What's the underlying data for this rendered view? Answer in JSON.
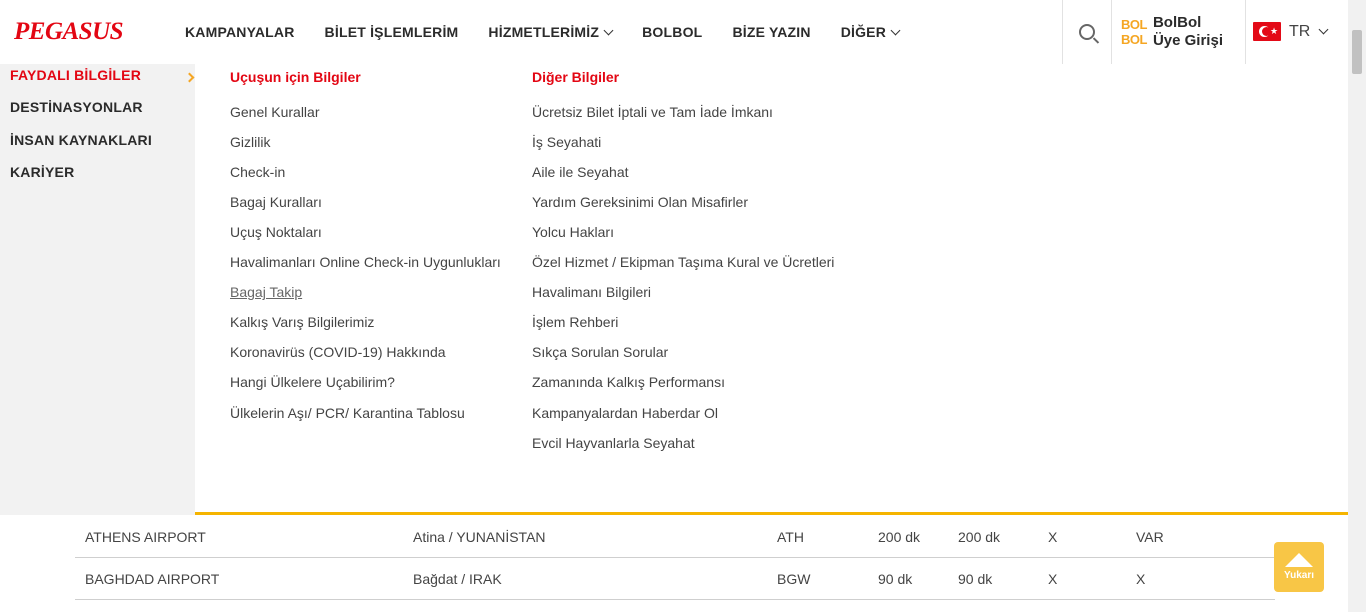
{
  "header": {
    "logo": "PEGASUS",
    "nav": [
      "KAMPANYALAR",
      "BİLET İŞLEMLERİM",
      "HİZMETLERİMİZ",
      "BOLBOL",
      "BİZE YAZIN",
      "DİĞER"
    ],
    "bolbol_logo_line1": "BOL",
    "bolbol_logo_line2": "BOL",
    "bolbol_line1": "BolBol",
    "bolbol_line2": "Üye Girişi",
    "lang": "TR"
  },
  "menu": {
    "side": [
      "FAYDALI BİLGİLER",
      "DESTİNASYONLAR",
      "İNSAN KAYNAKLARI",
      "KARİYER"
    ],
    "col1_title": "Uçuşun için Bilgiler",
    "col1": [
      "Genel Kurallar",
      "Gizlilik",
      "Check-in",
      "Bagaj Kuralları",
      "Uçuş Noktaları",
      "Havalimanları Online Check-in Uygunlukları",
      "Bagaj Takip",
      "Kalkış Varış Bilgilerimiz",
      "Koronavirüs (COVID-19) Hakkında",
      "Hangi Ülkelere Uçabilirim?",
      "Ülkelerin Aşı/ PCR/ Karantina Tablosu"
    ],
    "col2_title": "Diğer Bilgiler",
    "col2": [
      "Ücretsiz Bilet İptali ve Tam İade İmkanı",
      "İş Seyahati",
      "Aile ile Seyahat",
      "Yardım Gereksinimi Olan Misafirler",
      "Yolcu Hakları",
      "Özel Hizmet / Ekipman Taşıma Kural ve Ücretleri",
      "Havalimanı Bilgileri",
      "İşlem Rehberi",
      "Sıkça Sorulan Sorular",
      "Zamanında Kalkış Performansı",
      "Kampanyalardan Haberdar Ol",
      "Evcil Hayvanlarla Seyahat"
    ]
  },
  "table": {
    "rows": [
      [
        "ATHENS AIRPORT",
        "Atina / YUNANİSTAN",
        "ATH",
        "200 dk",
        "200 dk",
        "X",
        "VAR"
      ],
      [
        "BAGHDAD AIRPORT",
        "Bağdat / IRAK",
        "BGW",
        "90 dk",
        "90 dk",
        "X",
        "X"
      ]
    ]
  },
  "totop": "Yukarı",
  "colors": {
    "brand_red": "#e30613",
    "accent_yellow": "#f5b400",
    "bolbol_orange": "#f5a623"
  },
  "icons": {
    "search": "search-icon",
    "flag": "turkey-flag-icon",
    "chevron": "chevron-down-icon",
    "arrow_up": "arrow-up-icon"
  }
}
